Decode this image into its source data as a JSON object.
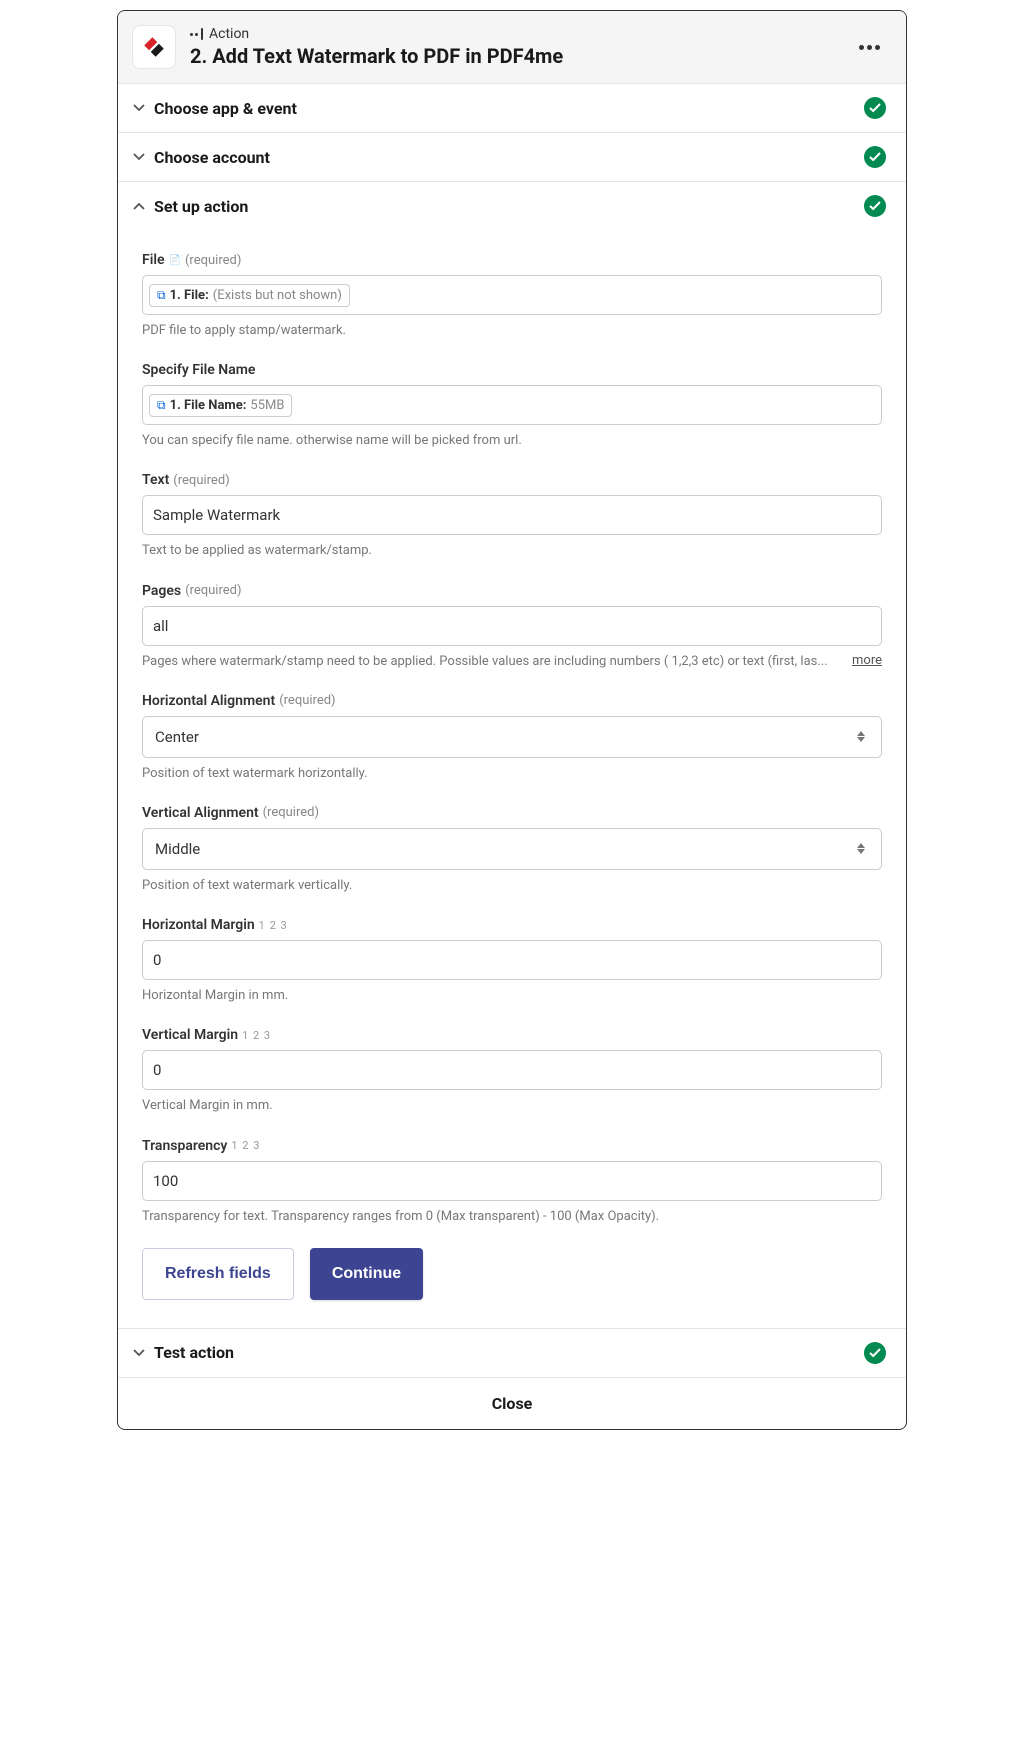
{
  "header": {
    "kicker": "Action",
    "title": "2. Add Text Watermark to PDF in PDF4me"
  },
  "sections": {
    "choose_app": "Choose app & event",
    "choose_account": "Choose account",
    "setup": "Set up action",
    "test": "Test action"
  },
  "fields": {
    "file": {
      "label": "File",
      "required": "(required)",
      "token_prefix": "1. File:",
      "token_value": "(Exists but not shown)",
      "help": "PDF file to apply stamp/watermark."
    },
    "filename": {
      "label": "Specify File Name",
      "token_prefix": "1. File Name:",
      "token_value": "55MB",
      "help": "You can specify file name. otherwise name will be picked from url."
    },
    "text": {
      "label": "Text",
      "required": "(required)",
      "value": "Sample Watermark",
      "help": "Text to be applied as watermark/stamp."
    },
    "pages": {
      "label": "Pages",
      "required": "(required)",
      "value": "all",
      "help": "Pages where watermark/stamp need to be applied. Possible values are including numbers ( 1,2,3 etc) or text (first, las...",
      "more": "more"
    },
    "halign": {
      "label": "Horizontal Alignment",
      "required": "(required)",
      "value": "Center",
      "help": "Position of text watermark horizontally."
    },
    "valign": {
      "label": "Vertical Alignment",
      "required": "(required)",
      "value": "Middle",
      "help": "Position of text watermark vertically."
    },
    "hmargin": {
      "label": "Horizontal Margin",
      "nums": "1 2 3",
      "value": "0",
      "help": "Horizontal Margin in mm."
    },
    "vmargin": {
      "label": "Vertical Margin",
      "nums": "1 2 3",
      "value": "0",
      "help": "Vertical Margin in mm."
    },
    "transparency": {
      "label": "Transparency",
      "nums": "1 2 3",
      "value": "100",
      "help": "Transparency for text. Transparency ranges from 0 (Max transparent) - 100 (Max Opacity)."
    }
  },
  "buttons": {
    "refresh": "Refresh fields",
    "continue": "Continue",
    "close": "Close"
  }
}
